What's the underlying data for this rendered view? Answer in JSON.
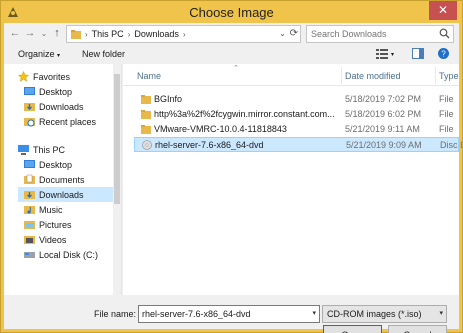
{
  "window": {
    "title": "Choose Image"
  },
  "address": {
    "parts": [
      "This PC",
      "Downloads"
    ]
  },
  "search": {
    "placeholder": "Search Downloads"
  },
  "toolbar": {
    "organize_label": "Organize",
    "new_folder_label": "New folder"
  },
  "nav": {
    "favorites_label": "Favorites",
    "favorites": [
      "Desktop",
      "Downloads",
      "Recent places"
    ],
    "thispc_label": "This PC",
    "thispc": [
      "Desktop",
      "Documents",
      "Downloads",
      "Music",
      "Pictures",
      "Videos",
      "Local Disk (C:)"
    ]
  },
  "columns": {
    "name": "Name",
    "date": "Date modified",
    "type": "Type"
  },
  "files": [
    {
      "name": "BGInfo",
      "date": "5/18/2019 7:02 PM",
      "type": "File",
      "icon": "folder-icon"
    },
    {
      "name": "http%3a%2f%2fcygwin.mirror.constant.com...",
      "date": "5/18/2019 6:02 PM",
      "type": "File",
      "icon": "folder-icon"
    },
    {
      "name": "VMware-VMRC-10.0.4-11818843",
      "date": "5/21/2019 9:11 AM",
      "type": "File",
      "icon": "folder-icon"
    },
    {
      "name": "rhel-server-7.6-x86_64-dvd",
      "date": "5/21/2019 9:09 AM",
      "type": "Disc I",
      "icon": "disc-image-icon"
    }
  ],
  "bottom": {
    "file_name_label": "File name:",
    "file_name_value": "rhel-server-7.6-x86_64-dvd",
    "filter_value": "CD-ROM images (*.iso)",
    "open_label": "Open",
    "cancel_label": "Cancel"
  },
  "colors": {
    "titlebar": "#f0c44a",
    "close": "#c75050",
    "selection": "#cce8ff",
    "folder": "#e8b84a"
  }
}
